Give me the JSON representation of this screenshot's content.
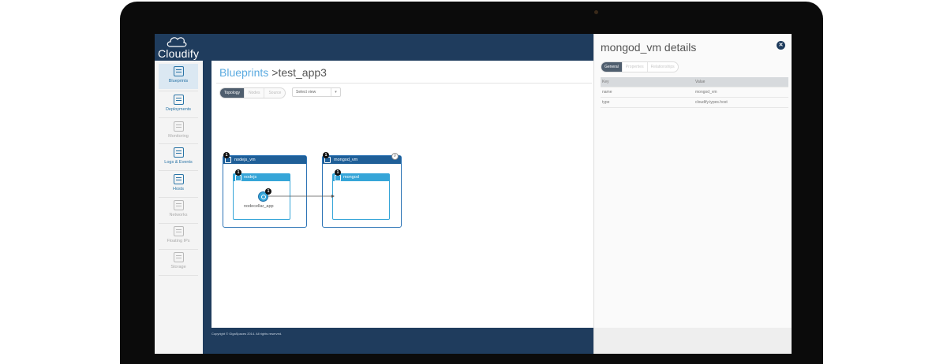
{
  "app": {
    "logo_text": "Cloudify"
  },
  "sidebar": {
    "items": [
      {
        "label": "Blueprints",
        "state": "active"
      },
      {
        "label": "Deployments",
        "state": "enabled"
      },
      {
        "label": "Monitoring",
        "state": "disabled"
      },
      {
        "label": "Logs & Events",
        "state": "enabled"
      },
      {
        "label": "Hosts",
        "state": "enabled"
      },
      {
        "label": "Networks",
        "state": "disabled"
      },
      {
        "label": "Floating IPs",
        "state": "disabled"
      },
      {
        "label": "Storage",
        "state": "disabled"
      }
    ]
  },
  "breadcrumb": {
    "root": "Blueprints",
    "current": ">test_app3"
  },
  "view_tabs": [
    {
      "label": "Topology",
      "active": true
    },
    {
      "label": "Nodes",
      "active": false
    },
    {
      "label": "Source",
      "active": false
    }
  ],
  "select_view": {
    "value": "Select view"
  },
  "topology": {
    "nodes": [
      {
        "name": "nodejs_vm",
        "instances": "1",
        "children": [
          {
            "name": "nodejs",
            "instances": "1",
            "apps": [
              {
                "name": "nodecellar_app",
                "instances": "1"
              }
            ]
          }
        ]
      },
      {
        "name": "mongod_vm",
        "instances": "1",
        "children": [
          {
            "name": "mongod",
            "instances": "1"
          }
        ]
      }
    ],
    "connection": {
      "from": "nodecellar_app",
      "to": "mongod"
    }
  },
  "footer": {
    "copyright": "Copyright © GigaSpaces 2014. All rights reserved."
  },
  "details": {
    "title": "mongod_vm details",
    "tabs": [
      {
        "label": "General",
        "active": true
      },
      {
        "label": "Properties",
        "active": false
      },
      {
        "label": "Relationships",
        "active": false
      }
    ],
    "table": {
      "headers": [
        "Key",
        "Value"
      ],
      "rows": [
        [
          "name",
          "mongod_vm"
        ],
        [
          "type",
          "cloudify.types.host"
        ]
      ]
    }
  },
  "colors": {
    "brand_navy": "#1f3c5d",
    "accent_blue": "#5aaae0",
    "node_blue": "#2c73b5",
    "inner_blue": "#35a5d8"
  }
}
